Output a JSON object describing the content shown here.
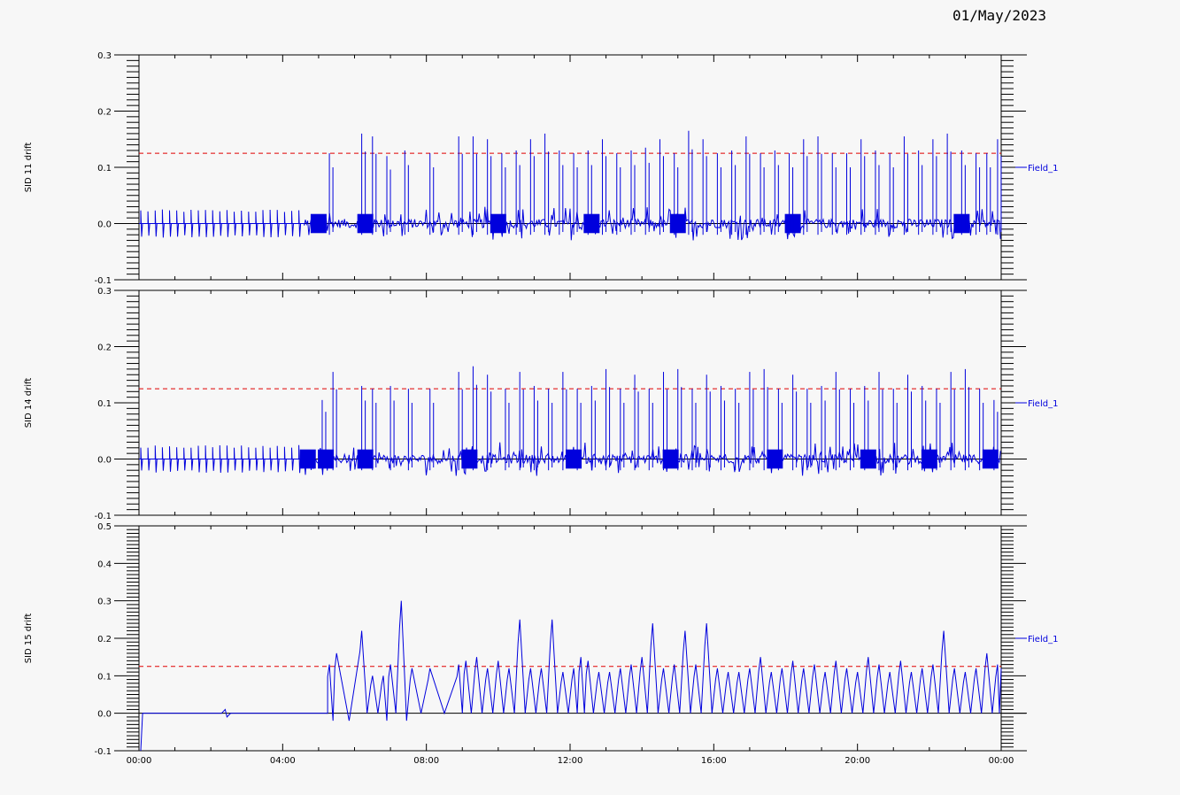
{
  "date_label": "01/May/2023",
  "chart_data": [
    {
      "type": "line",
      "ylabel": "SID 11 drift",
      "ylim": [
        -0.1,
        0.3
      ],
      "yticks": [
        -0.1,
        0.0,
        0.1,
        0.2,
        0.3
      ],
      "ytick_labels": [
        "-0.1",
        "0.0",
        "0.1",
        "0.2",
        "0.3"
      ],
      "xlim": [
        "00:00",
        "24:00"
      ],
      "xtick_labels": [
        "00:00",
        "04:00",
        "08:00",
        "12:00",
        "16:00",
        "20:00",
        "00:00"
      ],
      "threshold": 0.125,
      "threshold_color": "#e00000",
      "series": [
        {
          "name": "Field_1",
          "color": "#0000dd"
        }
      ],
      "spike_hours": [
        5.3,
        6.2,
        6.5,
        6.9,
        7.4,
        8.1,
        8.9,
        9.3,
        9.7,
        10.1,
        10.5,
        10.9,
        11.3,
        11.7,
        12.1,
        12.5,
        12.9,
        13.3,
        13.7,
        14.1,
        14.5,
        14.9,
        15.3,
        15.7,
        16.1,
        16.5,
        16.9,
        17.3,
        17.7,
        18.1,
        18.5,
        18.9,
        19.3,
        19.7,
        20.1,
        20.5,
        20.9,
        21.3,
        21.7,
        22.1,
        22.5,
        22.9,
        23.3,
        23.6,
        23.9
      ],
      "spike_values": [
        0.125,
        0.16,
        0.155,
        0.12,
        0.13,
        0.125,
        0.155,
        0.155,
        0.15,
        0.125,
        0.13,
        0.15,
        0.16,
        0.13,
        0.125,
        0.13,
        0.15,
        0.125,
        0.13,
        0.135,
        0.15,
        0.125,
        0.165,
        0.15,
        0.125,
        0.13,
        0.155,
        0.125,
        0.13,
        0.125,
        0.15,
        0.155,
        0.125,
        0.125,
        0.15,
        0.13,
        0.125,
        0.155,
        0.13,
        0.15,
        0.16,
        0.13,
        0.125,
        0.125,
        0.15
      ],
      "burst_hours": [
        5.0,
        6.3,
        10.0,
        12.6,
        15.0,
        18.2,
        22.9
      ]
    },
    {
      "type": "line",
      "ylabel": "SID 14 drift",
      "ylim": [
        -0.1,
        0.3
      ],
      "yticks": [
        -0.1,
        0.0,
        0.1,
        0.2,
        0.3
      ],
      "ytick_labels": [
        "-0.1",
        "0.0",
        "0.1",
        "0.2",
        "0.3"
      ],
      "xlim": [
        "00:00",
        "24:00"
      ],
      "xtick_labels": [
        "00:00",
        "04:00",
        "08:00",
        "12:00",
        "16:00",
        "20:00",
        "00:00"
      ],
      "threshold": 0.125,
      "threshold_color": "#e00000",
      "series": [
        {
          "name": "Field_1",
          "color": "#0000dd"
        }
      ],
      "spike_hours": [
        5.1,
        5.4,
        6.2,
        6.5,
        7.0,
        7.5,
        8.1,
        8.9,
        9.3,
        9.7,
        10.2,
        10.6,
        11.0,
        11.4,
        11.8,
        12.2,
        12.6,
        13.0,
        13.4,
        13.8,
        14.2,
        14.6,
        15.0,
        15.4,
        15.8,
        16.2,
        16.6,
        17.0,
        17.4,
        17.8,
        18.2,
        18.6,
        19.0,
        19.4,
        19.8,
        20.2,
        20.6,
        21.0,
        21.4,
        21.8,
        22.2,
        22.6,
        23.0,
        23.4,
        23.8
      ],
      "spike_values": [
        0.105,
        0.155,
        0.13,
        0.125,
        0.13,
        0.125,
        0.125,
        0.155,
        0.165,
        0.15,
        0.125,
        0.155,
        0.13,
        0.125,
        0.155,
        0.125,
        0.13,
        0.16,
        0.125,
        0.15,
        0.125,
        0.155,
        0.16,
        0.125,
        0.15,
        0.13,
        0.125,
        0.155,
        0.16,
        0.125,
        0.15,
        0.125,
        0.13,
        0.155,
        0.125,
        0.13,
        0.155,
        0.125,
        0.15,
        0.13,
        0.125,
        0.155,
        0.16,
        0.125,
        0.105
      ],
      "burst_hours": [
        4.7,
        5.2,
        6.3,
        9.2,
        12.1,
        14.8,
        17.7,
        20.3,
        22.0,
        23.7
      ]
    },
    {
      "type": "line",
      "ylabel": "SID 15 drift",
      "ylim": [
        -0.1,
        0.5
      ],
      "yticks": [
        -0.1,
        0.0,
        0.1,
        0.2,
        0.3,
        0.4,
        0.5
      ],
      "ytick_labels": [
        "-0.1",
        "0.0",
        "0.1",
        "0.2",
        "0.3",
        "0.4",
        "0.5"
      ],
      "xlim": [
        "00:00",
        "24:00"
      ],
      "xtick_labels": [
        "00:00",
        "04:00",
        "08:00",
        "12:00",
        "16:00",
        "20:00",
        "00:00"
      ],
      "threshold": 0.125,
      "threshold_color": "#e00000",
      "series": [
        {
          "name": "Field_1",
          "color": "#0000dd"
        }
      ],
      "peak_hours": [
        5.3,
        5.5,
        6.2,
        6.5,
        6.8,
        7.0,
        7.3,
        7.6,
        8.1,
        8.9,
        9.1,
        9.4,
        9.7,
        10.0,
        10.3,
        10.6,
        10.9,
        11.2,
        11.5,
        11.8,
        12.1,
        12.3,
        12.5,
        12.8,
        13.1,
        13.4,
        13.7,
        14.0,
        14.3,
        14.6,
        14.9,
        15.2,
        15.5,
        15.8,
        16.1,
        16.4,
        16.7,
        17.0,
        17.3,
        17.6,
        17.9,
        18.2,
        18.5,
        18.8,
        19.1,
        19.4,
        19.7,
        20.0,
        20.3,
        20.6,
        20.9,
        21.2,
        21.5,
        21.8,
        22.1,
        22.4,
        22.7,
        23.0,
        23.3,
        23.6,
        23.9
      ],
      "peak_values": [
        0.13,
        0.16,
        0.22,
        0.1,
        0.1,
        0.13,
        0.3,
        0.12,
        0.12,
        0.13,
        0.14,
        0.15,
        0.12,
        0.14,
        0.12,
        0.25,
        0.12,
        0.12,
        0.25,
        0.11,
        0.12,
        0.15,
        0.14,
        0.11,
        0.11,
        0.12,
        0.13,
        0.15,
        0.24,
        0.12,
        0.13,
        0.22,
        0.13,
        0.24,
        0.12,
        0.11,
        0.11,
        0.12,
        0.15,
        0.11,
        0.12,
        0.14,
        0.12,
        0.13,
        0.11,
        0.14,
        0.12,
        0.11,
        0.15,
        0.13,
        0.11,
        0.14,
        0.11,
        0.12,
        0.13,
        0.22,
        0.12,
        0.11,
        0.12,
        0.16,
        0.13
      ]
    }
  ]
}
